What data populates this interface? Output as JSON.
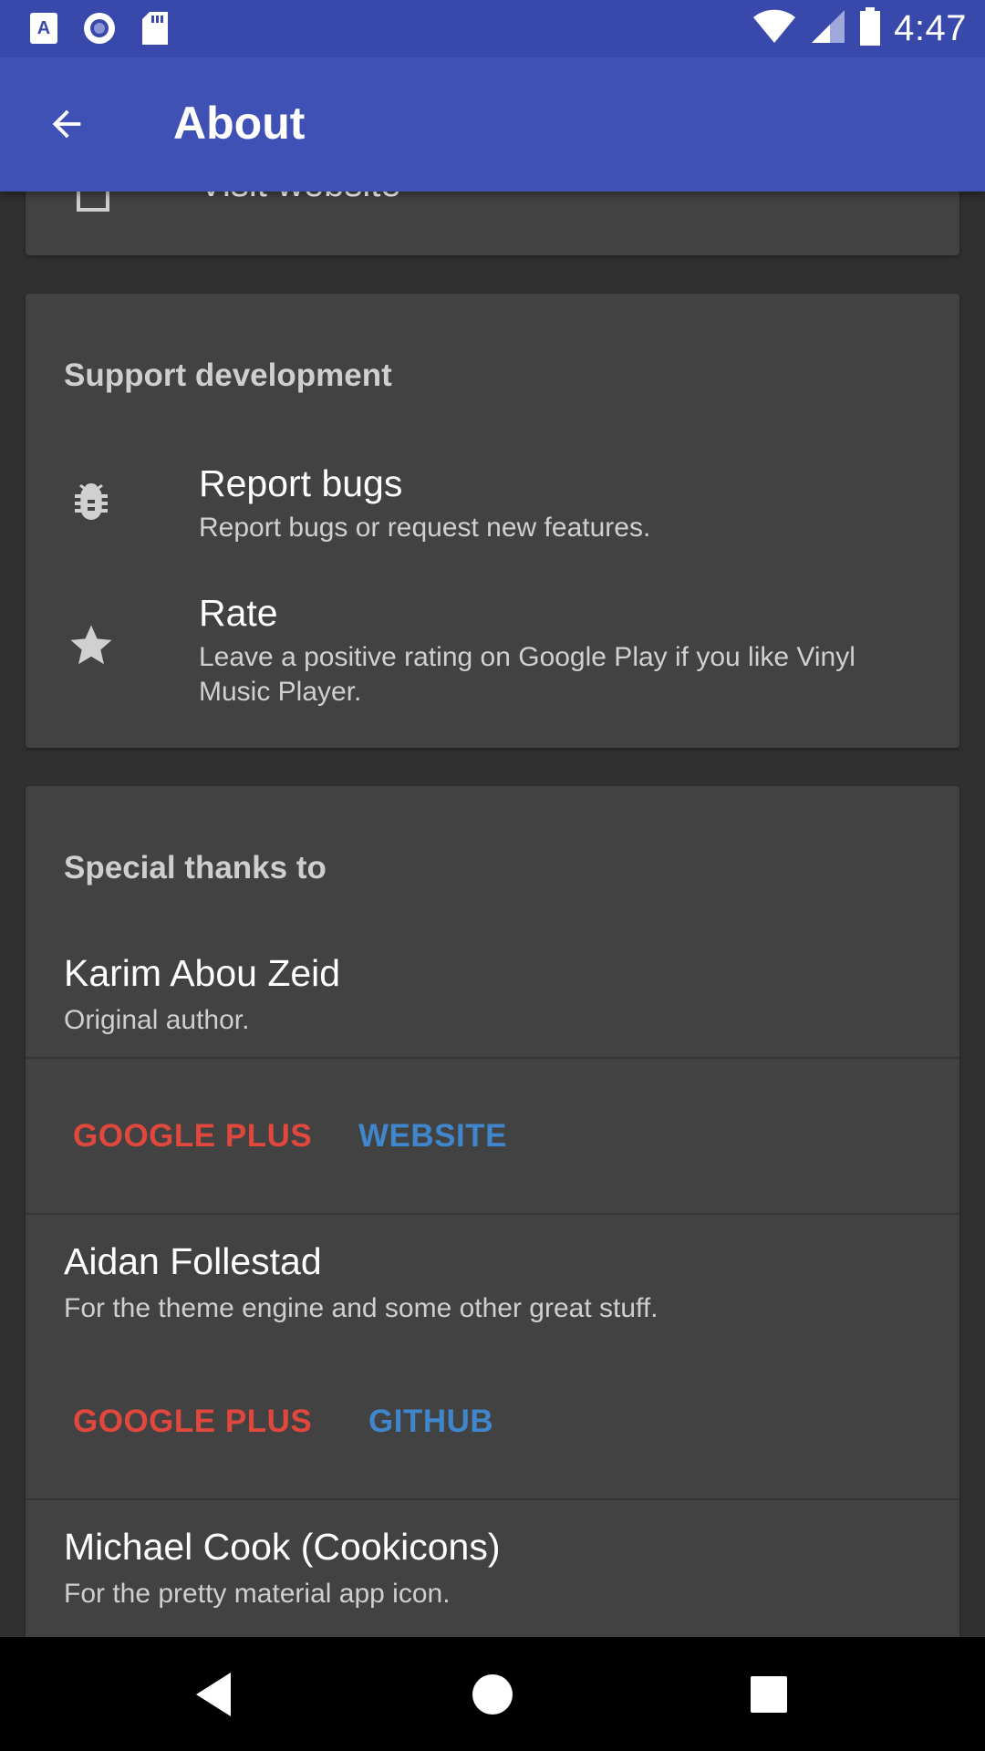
{
  "status_bar": {
    "time": "4:47",
    "icons": [
      "a-notification-icon",
      "circle-notification-icon",
      "sd-card-icon",
      "wifi-icon",
      "signal-icon",
      "battery-icon"
    ]
  },
  "app_bar": {
    "title": "About",
    "back_icon": "arrow-left-icon"
  },
  "partial_card": {
    "label": "Visit website",
    "icon": "website-icon"
  },
  "support": {
    "title": "Support development",
    "items": [
      {
        "icon": "bug-icon",
        "title": "Report bugs",
        "subtitle": "Report bugs or request new features."
      },
      {
        "icon": "star-icon",
        "title": "Rate",
        "subtitle": "Leave a positive rating on Google Play if you like Vinyl Music Player."
      }
    ]
  },
  "thanks": {
    "title": "Special thanks to",
    "people": [
      {
        "name": "Karim Abou Zeid",
        "desc": "Original author.",
        "links": [
          "GOOGLE PLUS",
          "WEBSITE"
        ]
      },
      {
        "name": "Aidan Follestad",
        "desc": "For the theme engine and some other great stuff.",
        "links": [
          "GOOGLE PLUS",
          "GITHUB"
        ]
      },
      {
        "name": "Michael Cook (Cookicons)",
        "desc": "For the pretty material app icon.",
        "links": []
      }
    ]
  },
  "nav_bar": {
    "icons": [
      "nav-back-icon",
      "nav-home-icon",
      "nav-recents-icon"
    ]
  },
  "colors": {
    "status_bar": "#3949AB",
    "app_bar": "#3F51B5",
    "background": "#303030",
    "card": "#424242",
    "link_red": "#E0473D",
    "link_blue": "#3F86CC"
  }
}
